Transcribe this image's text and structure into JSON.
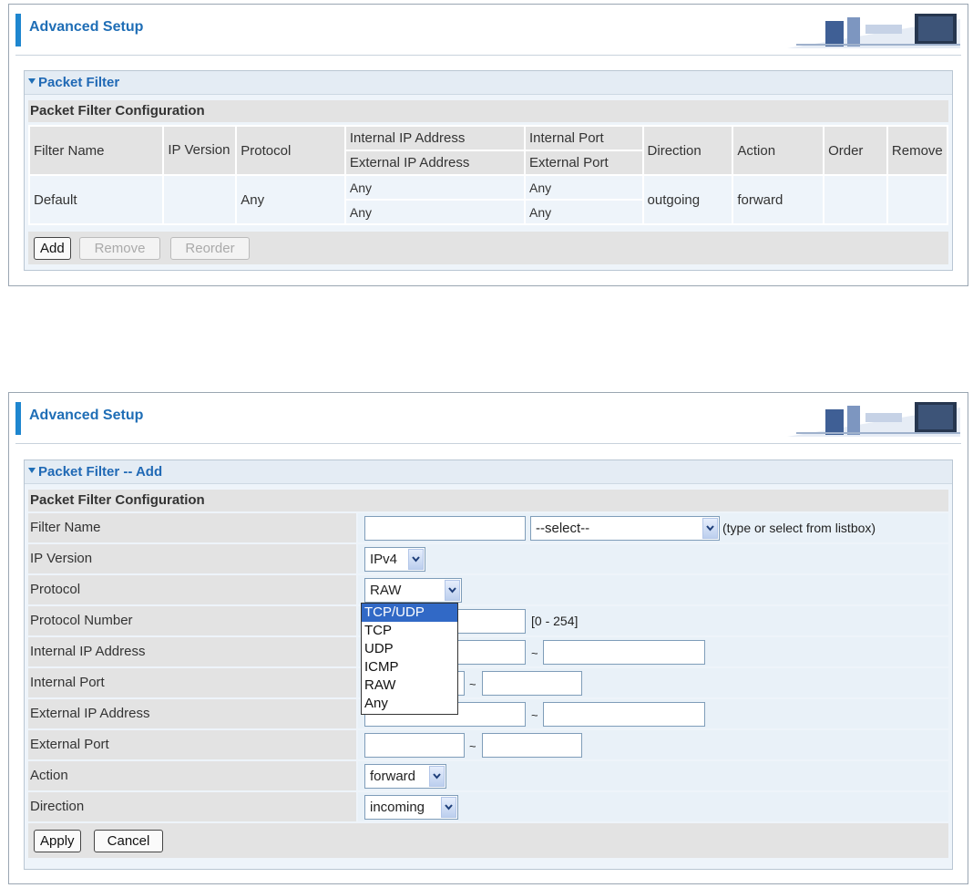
{
  "list_view": {
    "header_title": "Advanced Setup",
    "panel_title": "Packet Filter",
    "section_title": "Packet Filter Configuration",
    "columns": {
      "filter_name": "Filter Name",
      "ip_version": "IP Version",
      "protocol": "Protocol",
      "internal_ip": "Internal IP Address",
      "external_ip": "External IP Address",
      "internal_port": "Internal Port",
      "external_port": "External Port",
      "direction": "Direction",
      "action": "Action",
      "order": "Order",
      "remove": "Remove"
    },
    "row": {
      "filter_name": "Default",
      "ip_version": "",
      "protocol": "Any",
      "internal_ip": "Any",
      "external_ip": "Any",
      "internal_port": "Any",
      "external_port": "Any",
      "direction": "outgoing",
      "action": "forward"
    },
    "buttons": {
      "add": "Add",
      "remove": "Remove",
      "reorder": "Reorder"
    }
  },
  "add_view": {
    "header_title": "Advanced Setup",
    "panel_title": "Packet Filter -- Add",
    "section_title": "Packet Filter Configuration",
    "labels": {
      "filter_name": "Filter Name",
      "ip_version": "IP Version",
      "protocol": "Protocol",
      "protocol_number": "Protocol Number",
      "internal_ip": "Internal IP Address",
      "internal_port": "Internal Port",
      "external_ip": "External IP Address",
      "external_port": "External Port",
      "action": "Action",
      "direction": "Direction"
    },
    "filter_name_select": "--select--",
    "filter_name_hint": "(type or select from listbox)",
    "ip_version_value": "IPv4",
    "protocol_value": "RAW",
    "protocol_number_hint": "[0 - 254]",
    "range_sep": "~",
    "action_value": "forward",
    "direction_value": "incoming",
    "protocol_options": [
      "TCP/UDP",
      "TCP",
      "UDP",
      "ICMP",
      "RAW",
      "Any"
    ],
    "buttons": {
      "apply": "Apply",
      "cancel": "Cancel"
    }
  },
  "colors": {
    "title_blue": "#1f6eb6",
    "accent_bar": "#1e86cf",
    "label_bg": "#e3e3e3",
    "value_bg": "#e9f1f8",
    "highlight": "#3169c6"
  }
}
